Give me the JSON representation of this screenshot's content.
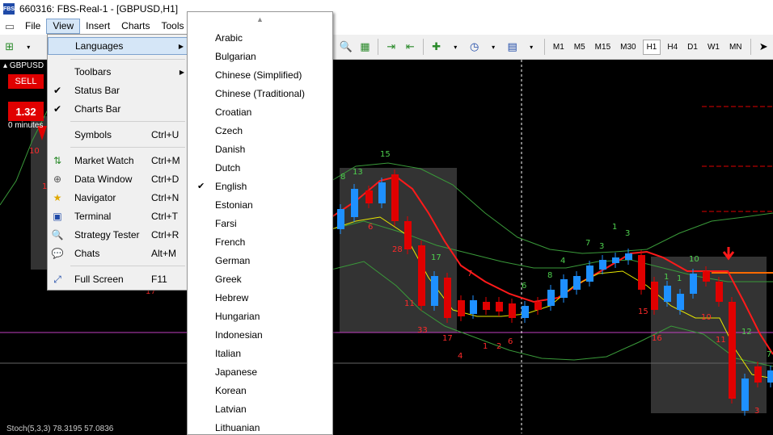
{
  "window": {
    "title": "660316: FBS-Real-1 - [GBPUSD,H1]",
    "icon_label": "FBS"
  },
  "menubar": {
    "items": [
      "File",
      "View",
      "Insert",
      "Charts",
      "Tools"
    ]
  },
  "toolbar": {
    "timeframes": [
      "M1",
      "M5",
      "M15",
      "M30",
      "H1",
      "H4",
      "D1",
      "W1",
      "MN"
    ],
    "active_timeframe": "H1"
  },
  "chart": {
    "symbol": "GBPUSD",
    "sell_label": "SELL",
    "sell_price": "1.32",
    "lot_label": "0 minutes",
    "indicator_label": "Stoch(5,3,3) 78.3195 57.0836",
    "numbers": [
      "10",
      "16",
      "17",
      "13",
      "15",
      "8",
      "6",
      "28",
      "17",
      "11",
      "33",
      "17",
      "7",
      "4",
      "1",
      "2",
      "6",
      "6",
      "8",
      "4",
      "7",
      "1",
      "3",
      "3",
      "1",
      "10",
      "1",
      "10",
      "15",
      "16",
      "11",
      "12",
      "7",
      "3"
    ],
    "colors": {
      "bull": "#1e90ff",
      "bear": "#e00000",
      "ma_red": "#ff1a1a",
      "ma_yellow": "#e8e800",
      "band": "#3a9a3a",
      "level": "#c040c0"
    }
  },
  "view_menu": {
    "items": [
      {
        "label": "Languages",
        "shortcut": "",
        "icon": "",
        "submenu": true
      },
      {
        "label": "Toolbars",
        "shortcut": "",
        "icon": "",
        "submenu": true
      },
      {
        "label": "Status Bar",
        "shortcut": "",
        "icon": "check-icon"
      },
      {
        "label": "Charts Bar",
        "shortcut": "",
        "icon": "check-icon"
      },
      {
        "label": "Symbols",
        "shortcut": "Ctrl+U",
        "icon": ""
      },
      {
        "label": "Market Watch",
        "shortcut": "Ctrl+M",
        "icon": "market-watch-icon"
      },
      {
        "label": "Data Window",
        "shortcut": "Ctrl+D",
        "icon": "crosshair-icon"
      },
      {
        "label": "Navigator",
        "shortcut": "Ctrl+N",
        "icon": "star-icon"
      },
      {
        "label": "Terminal",
        "shortcut": "Ctrl+T",
        "icon": "terminal-icon"
      },
      {
        "label": "Strategy Tester",
        "shortcut": "Ctrl+R",
        "icon": "magnifier-icon"
      },
      {
        "label": "Chats",
        "shortcut": "Alt+M",
        "icon": "chat-icon"
      },
      {
        "label": "Full Screen",
        "shortcut": "F11",
        "icon": "fullscreen-icon"
      }
    ]
  },
  "languages_menu": {
    "selected": "English",
    "items": [
      "Arabic",
      "Bulgarian",
      "Chinese (Simplified)",
      "Chinese (Traditional)",
      "Croatian",
      "Czech",
      "Danish",
      "Dutch",
      "English",
      "Estonian",
      "Farsi",
      "French",
      "German",
      "Greek",
      "Hebrew",
      "Hungarian",
      "Indonesian",
      "Italian",
      "Japanese",
      "Korean",
      "Latvian",
      "Lithuanian"
    ]
  }
}
